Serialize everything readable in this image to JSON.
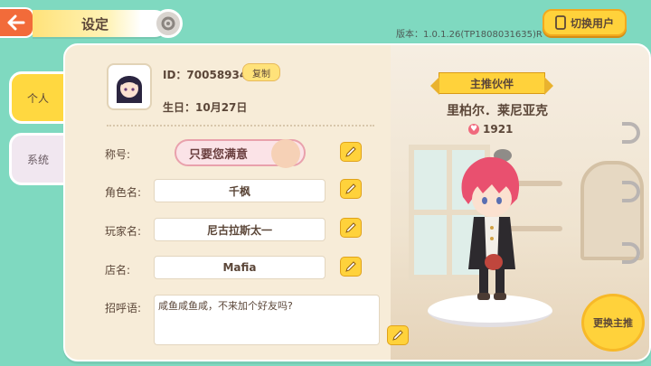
{
  "header": {
    "title": "设定",
    "version": "版本：1.0.1.26(TP1808031635)R",
    "switch_user_label": "切换用户"
  },
  "tabs": [
    {
      "label": "个人",
      "active": true
    },
    {
      "label": "系统",
      "active": false
    }
  ],
  "profile": {
    "id_text": "ID：70058934",
    "copy_label": "复制",
    "birthday_text": "生日：10月27日"
  },
  "fields": {
    "title_label": "称号:",
    "title_value": "只要您满意",
    "character_label": "角色名:",
    "character_value": "千枫",
    "player_label": "玩家名:",
    "player_value": "尼古拉斯太一",
    "shop_label": "店名:",
    "shop_value": "Mafia",
    "greeting_label": "招呼语:",
    "greeting_value": "咸鱼咸鱼咸，不来加个好友吗?"
  },
  "partner": {
    "ribbon_label": "主推伙伴",
    "name": "里柏尔．莱尼亚克",
    "affection": "1921",
    "change_label": "更换主推"
  },
  "colors": {
    "background": "#7fd9c0",
    "accent_yellow": "#ffd23b",
    "back_orange": "#f26b3a",
    "heart": "#f06a7d"
  }
}
